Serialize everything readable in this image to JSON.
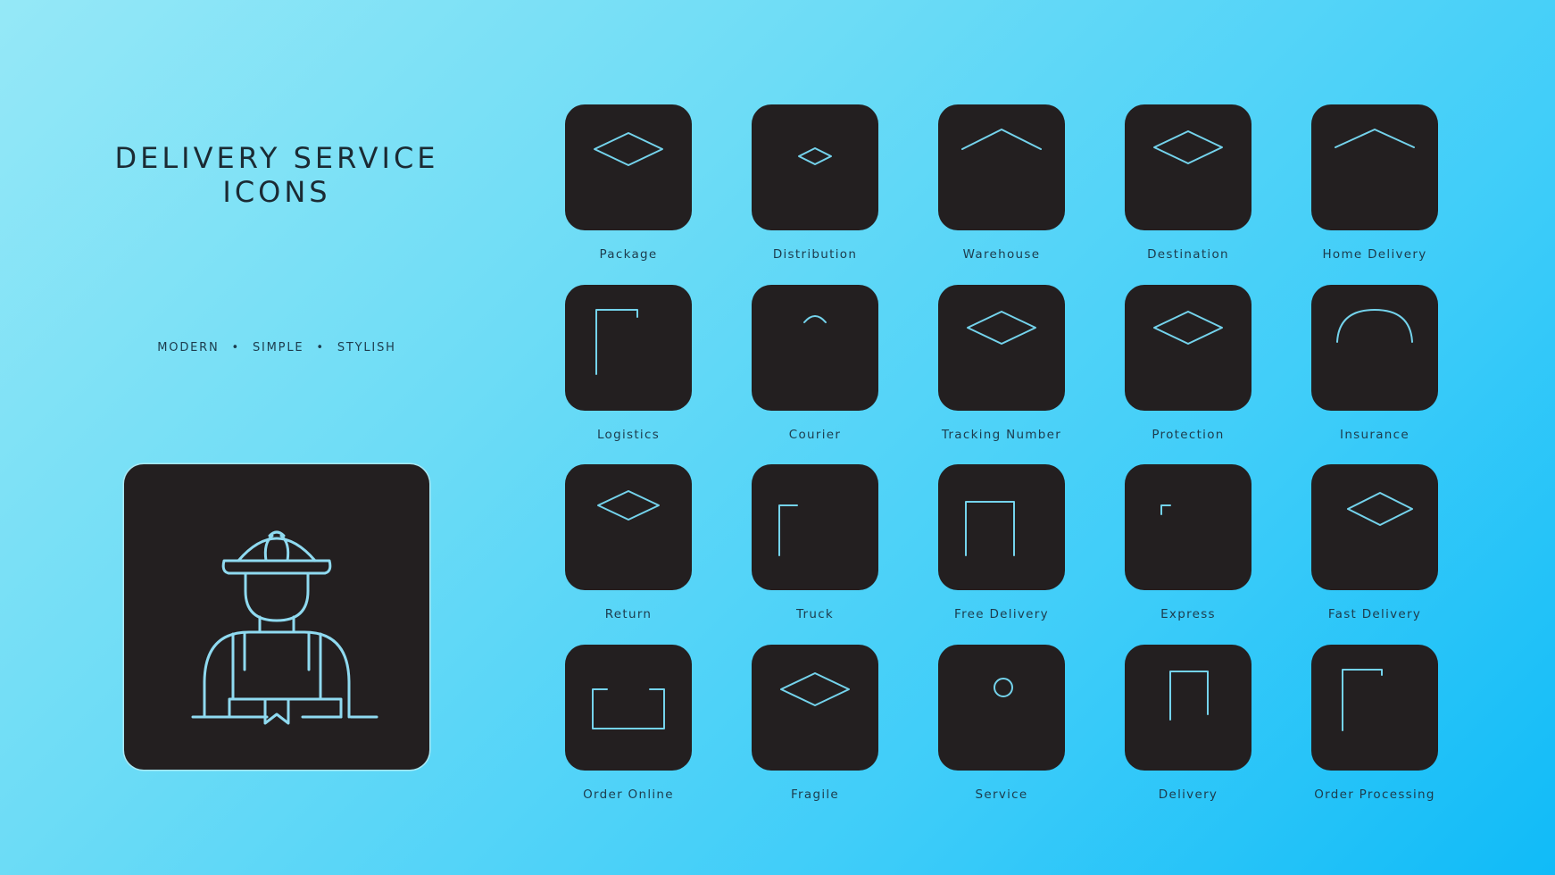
{
  "title": {
    "line1": "DELIVERY SERVICE",
    "line2": "ICONS"
  },
  "tagline": {
    "words": [
      "MODERN",
      "SIMPLE",
      "STYLISH"
    ],
    "separator": "•"
  },
  "hero": {
    "icon": "courier-icon"
  },
  "colors": {
    "background_start": "#95e8f7",
    "background_end": "#10bbf8",
    "tile": "#231f20",
    "icon_stroke": "#74d3ec",
    "text": "#1d3b4c"
  },
  "icons": [
    {
      "label": "Package",
      "icon": "package-icon"
    },
    {
      "label": "Distribution",
      "icon": "distribution-icon"
    },
    {
      "label": "Warehouse",
      "icon": "warehouse-icon"
    },
    {
      "label": "Destination",
      "icon": "destination-icon"
    },
    {
      "label": "Home Delivery",
      "icon": "home-delivery-icon"
    },
    {
      "label": "Logistics",
      "icon": "logistics-icon"
    },
    {
      "label": "Courier",
      "icon": "courier-icon"
    },
    {
      "label": "Tracking Number",
      "icon": "tracking-number-icon"
    },
    {
      "label": "Protection",
      "icon": "protection-icon"
    },
    {
      "label": "Insurance",
      "icon": "insurance-icon"
    },
    {
      "label": "Return",
      "icon": "return-icon"
    },
    {
      "label": "Truck",
      "icon": "truck-icon"
    },
    {
      "label": "Free Delivery",
      "icon": "free-delivery-icon"
    },
    {
      "label": "Express",
      "icon": "express-icon"
    },
    {
      "label": "Fast Delivery",
      "icon": "fast-delivery-icon"
    },
    {
      "label": "Order Online",
      "icon": "order-online-icon"
    },
    {
      "label": "Fragile",
      "icon": "fragile-icon"
    },
    {
      "label": "Service",
      "icon": "service-icon"
    },
    {
      "label": "Delivery",
      "icon": "delivery-icon"
    },
    {
      "label": "Order Processing",
      "icon": "order-processing-icon"
    }
  ]
}
